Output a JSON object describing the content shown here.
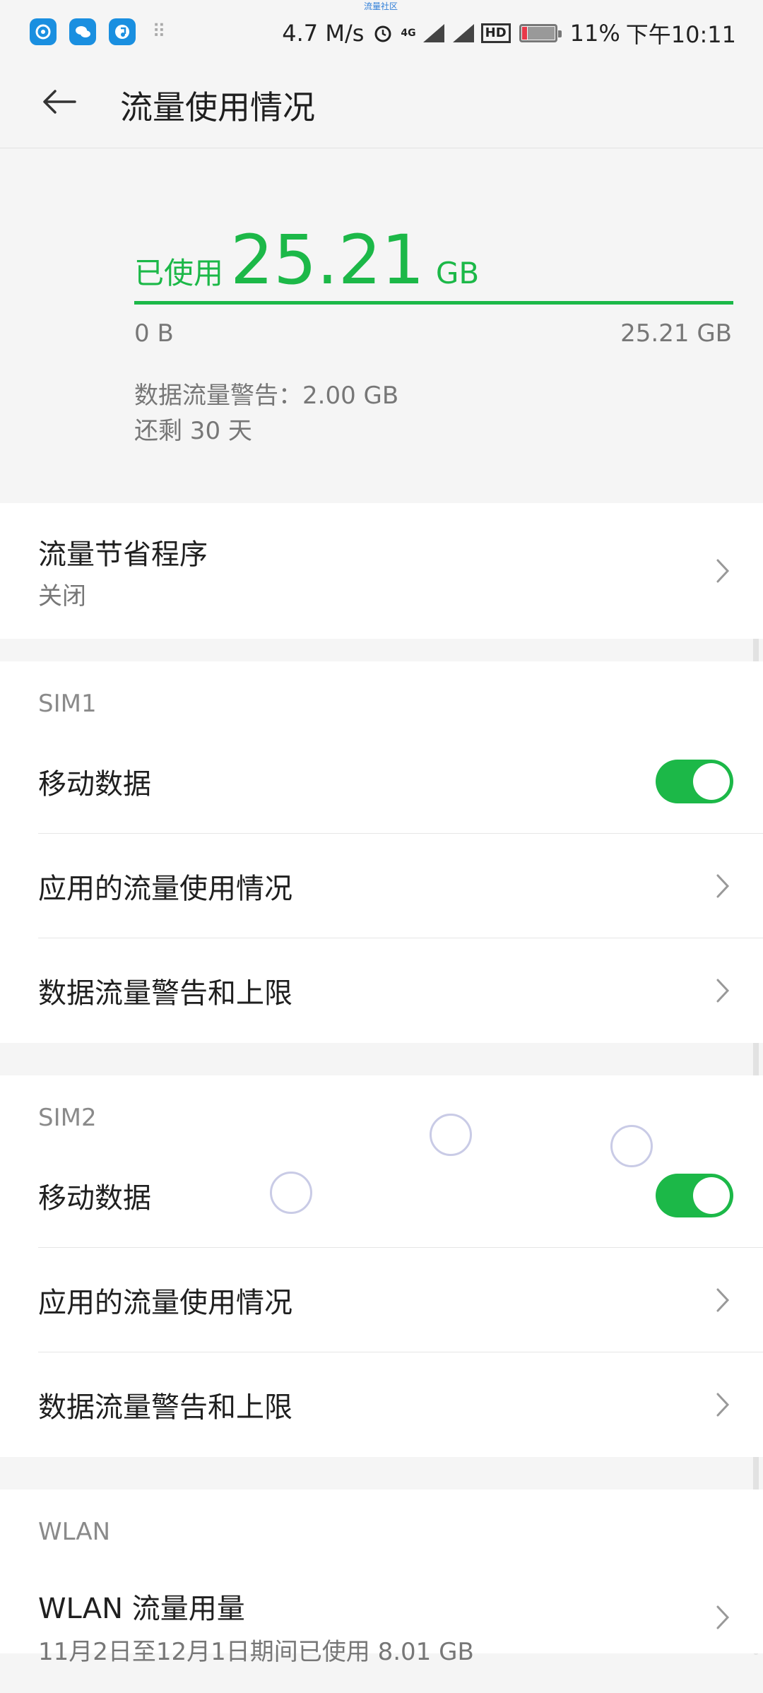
{
  "status_bar": {
    "banner": "流量社区",
    "speed": "4.7 M/s",
    "network": "4G",
    "hd_label": "HD",
    "battery_percent": "11%",
    "time": "下午10:11",
    "icons": [
      "netease-music-icon",
      "wechat-icon",
      "music-app-icon",
      "keypad-icon",
      "alarm-icon",
      "signal-icon",
      "signal-icon",
      "battery-icon"
    ]
  },
  "app_bar": {
    "back_icon": "back-arrow-icon",
    "title": "流量使用情况"
  },
  "usage_summary": {
    "used_label": "已使用",
    "used_value": "25.21",
    "used_unit": "GB",
    "scale_min": "0 B",
    "scale_max": "25.21 GB",
    "warning_line": "数据流量警告：2.00 GB",
    "remaining_line": "还剩 30 天",
    "accent_color": "#1cb848"
  },
  "data_saver": {
    "title": "流量节省程序",
    "status": "关闭"
  },
  "sim1": {
    "header": "SIM1",
    "mobile_data_label": "移动数据",
    "mobile_data_on": true,
    "app_usage_label": "应用的流量使用情况",
    "warning_limit_label": "数据流量警告和上限"
  },
  "sim2": {
    "header": "SIM2",
    "mobile_data_label": "移动数据",
    "mobile_data_on": true,
    "app_usage_label": "应用的流量使用情况",
    "warning_limit_label": "数据流量警告和上限"
  },
  "wlan": {
    "header": "WLAN",
    "usage_label": "WLAN 流量用量",
    "usage_sub": "11月2日至12月1日期间已使用 8.01 GB"
  }
}
